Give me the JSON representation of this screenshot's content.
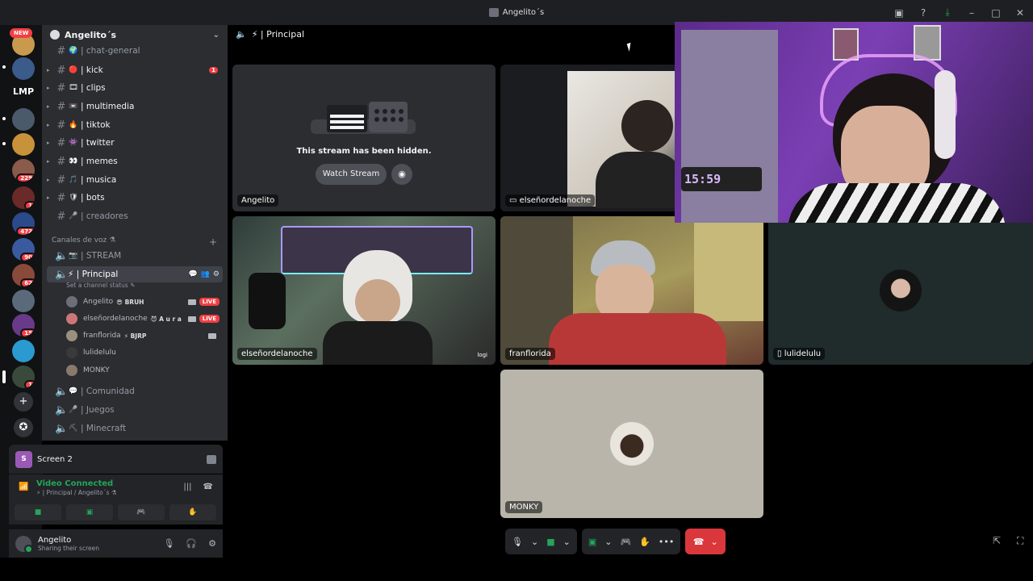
{
  "window": {
    "title": "Angelito´s",
    "title_icon": "server-icon"
  },
  "servers": {
    "new_label": "NEW",
    "lmp_label": "LMP",
    "badges": [
      "229",
      "1",
      "472",
      "90",
      "62",
      "15",
      "1"
    ]
  },
  "server_header": {
    "name": "Angelito´s"
  },
  "text_channels": [
    {
      "emoji": "🌍",
      "name": "| chat-general"
    },
    {
      "emoji": "🔴",
      "name": "| kick",
      "badge": "1"
    },
    {
      "emoji": "🎞",
      "name": "| clips"
    },
    {
      "emoji": "📼",
      "name": "| multimedia"
    },
    {
      "emoji": "🔥",
      "name": "| tiktok"
    },
    {
      "emoji": "👾",
      "name": "| twitter"
    },
    {
      "emoji": "👀",
      "name": "| memes"
    },
    {
      "emoji": "🎵",
      "name": "| musica"
    },
    {
      "emoji": "🛡",
      "name": "| bots"
    },
    {
      "emoji": "🎤",
      "name": "| creadores"
    }
  ],
  "voice_category": {
    "label": "Canales de voz ⚗"
  },
  "voice_channels": {
    "stream": "| STREAM",
    "principal": "⚡ | Principal",
    "set_status": "Set a channel status ✎",
    "comunidad": "| Comunidad",
    "juegos": "| Juegos",
    "minecraft": "| Minecraft"
  },
  "voice_users": [
    {
      "name": "Angelito",
      "tag": "😎 BRUH",
      "live": "LIVE"
    },
    {
      "name": "elseñordelanoche",
      "tag": "😈 A u r a",
      "live": "LIVE"
    },
    {
      "name": "franflorida",
      "tag": "⚡ BJRP"
    },
    {
      "name": "lulidelulu",
      "tag": ""
    },
    {
      "name": "MONKY",
      "tag": ""
    }
  ],
  "screen_panel": {
    "icon_letter": "S",
    "name": "Screen 2"
  },
  "voice_panel": {
    "status": "Video Connected",
    "location": "⚡ | Principal / Angelito´s ⚗"
  },
  "user_panel": {
    "name": "Angelito",
    "status": "Sharing their screen"
  },
  "call": {
    "channel": "⚡ | Principal",
    "hidden_message": "This stream has been hidden.",
    "watch_label": "Watch Stream",
    "tiles": {
      "angelito": "Angelito",
      "screen_share": "elseñordelanoche",
      "elsenor_cam": "elseñordelanoche",
      "fran": "franflorida",
      "luli": "lulidelulu",
      "monky": "MONKY"
    },
    "cam_overlay": "logi",
    "clock": "15:59"
  }
}
